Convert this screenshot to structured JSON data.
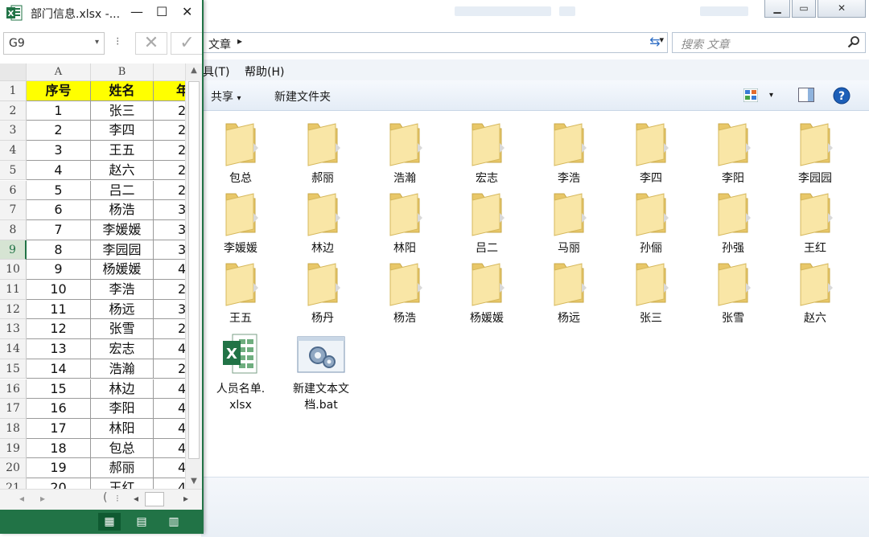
{
  "explorer": {
    "address": {
      "segment": "文章",
      "arrow": "▸",
      "dropdown": "▾"
    },
    "search": {
      "placeholder": "搜索 文章"
    },
    "menu": {
      "tools_partial": "具(T)",
      "help": "帮助(H)"
    },
    "toolbar": {
      "share": "共享",
      "share_arrow": "▾",
      "new_folder": "新建文件夹",
      "view_arrow": "▾"
    },
    "folders": [
      "包总",
      "郝丽",
      "浩瀚",
      "宏志",
      "李浩",
      "李四",
      "李阳",
      "李园园",
      "李媛媛",
      "林边",
      "林阳",
      "吕二",
      "马丽",
      "孙俪",
      "孙强",
      "王红",
      "王五",
      "杨丹",
      "杨浩",
      "杨媛媛",
      "杨远",
      "张三",
      "张雪",
      "赵六"
    ],
    "files": [
      {
        "name": "人员名单.xlsx",
        "line1": "人员名单.",
        "line2": "xlsx",
        "icon": "excel-file-icon"
      },
      {
        "name": "新建文本文档.bat",
        "line1": "新建文本文",
        "line2": "档.bat",
        "icon": "batch-file-icon"
      }
    ]
  },
  "excel": {
    "title": "部门信息.xlsx -...",
    "controls": {
      "minimize": "—",
      "maximize": "☐",
      "close": "✕"
    },
    "name_box": "G9",
    "formula_dots": "⁝",
    "cancel": "✕",
    "enter": "✓",
    "columns": [
      "A",
      "B"
    ],
    "selected_row": 9,
    "headers": [
      "序号",
      "姓名",
      "年"
    ],
    "rows": [
      [
        "1",
        "张三"
      ],
      [
        "2",
        "李四"
      ],
      [
        "3",
        "王五"
      ],
      [
        "4",
        "赵六"
      ],
      [
        "5",
        "吕二"
      ],
      [
        "6",
        "杨浩"
      ],
      [
        "7",
        "李媛媛"
      ],
      [
        "8",
        "李园园"
      ],
      [
        "9",
        "杨媛媛"
      ],
      [
        "10",
        "李浩"
      ],
      [
        "11",
        "杨远"
      ],
      [
        "12",
        "张雪"
      ],
      [
        "13",
        "宏志"
      ],
      [
        "14",
        "浩瀚"
      ],
      [
        "15",
        "林边"
      ],
      [
        "16",
        "李阳"
      ],
      [
        "17",
        "林阳"
      ],
      [
        "18",
        "包总"
      ],
      [
        "19",
        "郝丽"
      ],
      [
        "20",
        "王红"
      ]
    ],
    "row_numbers": [
      "1",
      "2",
      "3",
      "4",
      "5",
      "6",
      "7",
      "8",
      "9",
      "10",
      "11",
      "12",
      "13",
      "14",
      "15",
      "16",
      "17",
      "18",
      "19",
      "20",
      "21"
    ],
    "col_c_partial": [
      "2",
      "2",
      "2",
      "2",
      "2",
      "3",
      "3",
      "3",
      "4",
      "2",
      "3",
      "2",
      "4",
      "2",
      "4",
      "4",
      "4",
      "4",
      "4",
      "4"
    ],
    "sheet_nav": [
      "◂",
      "▸"
    ],
    "status_views": [
      "normal-view",
      "page-layout-view",
      "page-break-view"
    ]
  }
}
